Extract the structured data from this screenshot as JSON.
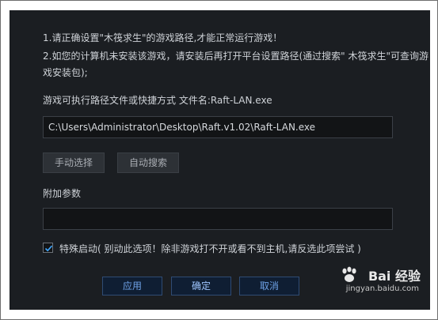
{
  "instructions": {
    "line1": "1.请正确设置\"木筏求生\"的游戏路径,才能正常运行游戏！",
    "line2": "2.如您的计算机未安装该游戏，请安装后再打开平台设置路径(通过搜索\" 木筏求生\"可查询游",
    "line3": "戏安装包);"
  },
  "path": {
    "label": "游戏可执行路径文件或快捷方式 文件名:Raft-LAN.exe",
    "value": "C:\\Users\\Administrator\\Desktop\\Raft.v1.02\\Raft-LAN.exe"
  },
  "buttons": {
    "manual_select": "手动选择",
    "auto_search": "自动搜索"
  },
  "params": {
    "label": "附加参数",
    "value": ""
  },
  "special_launch": {
    "checked": true,
    "label": "特殊启动( 别动此选项！除非游戏打不开或看不到主机,请反选此项尝试 )"
  },
  "footer": {
    "apply": "应用",
    "ok": "确定",
    "cancel": "取消"
  },
  "watermark": {
    "brand": "Bai  经验",
    "url": "jingyan.baidu.com"
  }
}
